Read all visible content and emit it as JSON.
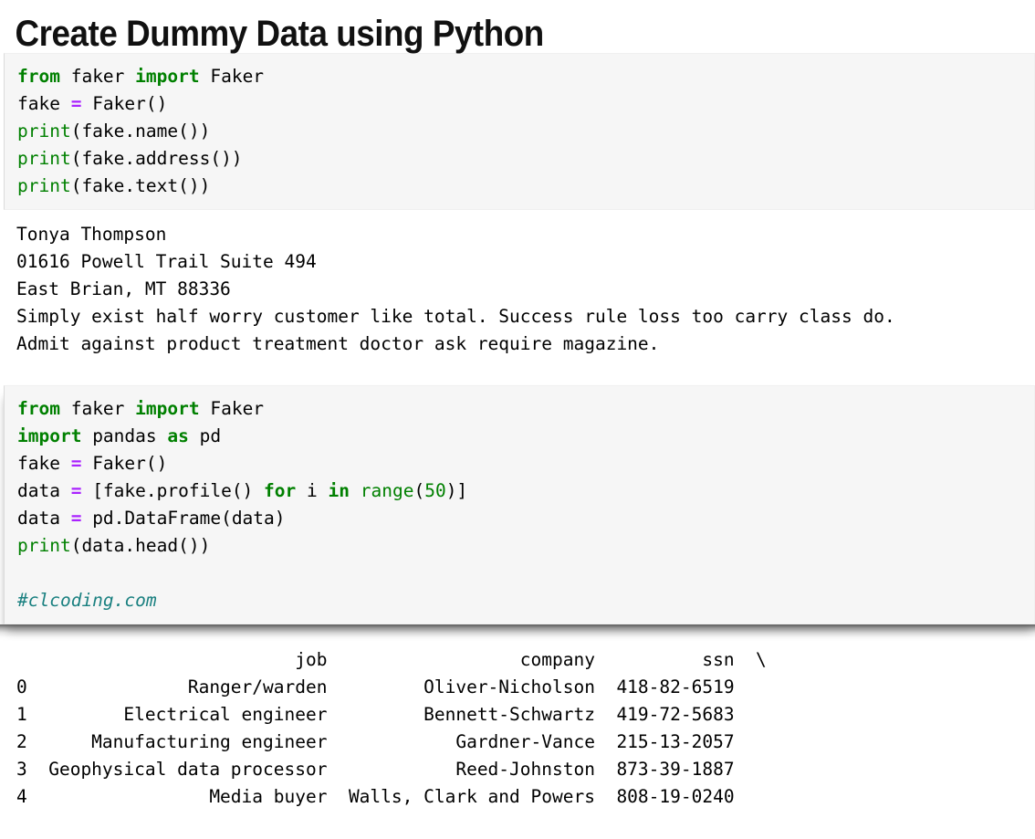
{
  "page": {
    "title": "Create Dummy Data using Python"
  },
  "code_block_1": {
    "lines": [
      [
        {
          "t": "from",
          "c": "kw"
        },
        {
          "t": " faker ",
          "c": ""
        },
        {
          "t": "import",
          "c": "kw"
        },
        {
          "t": " Faker",
          "c": ""
        }
      ],
      [
        {
          "t": "fake ",
          "c": ""
        },
        {
          "t": "=",
          "c": "op"
        },
        {
          "t": " Faker()",
          "c": ""
        }
      ],
      [
        {
          "t": "print",
          "c": "bi"
        },
        {
          "t": "(fake.name())",
          "c": ""
        }
      ],
      [
        {
          "t": "print",
          "c": "bi"
        },
        {
          "t": "(fake.address())",
          "c": ""
        }
      ],
      [
        {
          "t": "print",
          "c": "bi"
        },
        {
          "t": "(fake.text())",
          "c": ""
        }
      ]
    ],
    "plain": "from faker import Faker\nfake = Faker()\nprint(fake.name())\nprint(fake.address())\nprint(fake.text())"
  },
  "output_1": {
    "lines": [
      "Tonya Thompson",
      "01616 Powell Trail Suite 494",
      "East Brian, MT 88336",
      "Simply exist half worry customer like total. Success rule loss too carry class do.",
      "Admit against product treatment doctor ask require magazine."
    ]
  },
  "code_block_2": {
    "lines": [
      [
        {
          "t": "from",
          "c": "kw"
        },
        {
          "t": " faker ",
          "c": ""
        },
        {
          "t": "import",
          "c": "kw"
        },
        {
          "t": " Faker",
          "c": ""
        }
      ],
      [
        {
          "t": "import",
          "c": "kw"
        },
        {
          "t": " pandas ",
          "c": ""
        },
        {
          "t": "as",
          "c": "kw"
        },
        {
          "t": " pd",
          "c": ""
        }
      ],
      [
        {
          "t": "fake ",
          "c": ""
        },
        {
          "t": "=",
          "c": "op"
        },
        {
          "t": " Faker()",
          "c": ""
        }
      ],
      [
        {
          "t": "data ",
          "c": ""
        },
        {
          "t": "=",
          "c": "op"
        },
        {
          "t": " [fake.profile() ",
          "c": ""
        },
        {
          "t": "for",
          "c": "kw"
        },
        {
          "t": " i ",
          "c": ""
        },
        {
          "t": "in",
          "c": "kw"
        },
        {
          "t": " ",
          "c": ""
        },
        {
          "t": "range",
          "c": "bi"
        },
        {
          "t": "(",
          "c": ""
        },
        {
          "t": "50",
          "c": "num"
        },
        {
          "t": ")]",
          "c": ""
        }
      ],
      [
        {
          "t": "data ",
          "c": ""
        },
        {
          "t": "=",
          "c": "op"
        },
        {
          "t": " pd.DataFrame(data)",
          "c": ""
        }
      ],
      [
        {
          "t": "print",
          "c": "bi"
        },
        {
          "t": "(data.head())",
          "c": ""
        }
      ],
      [
        {
          "t": "",
          "c": ""
        }
      ],
      [
        {
          "t": "#clcoding.com",
          "c": "cmt"
        }
      ]
    ],
    "plain": "from faker import Faker\nimport pandas as pd\nfake = Faker()\ndata = [fake.profile() for i in range(50)]\ndata = pd.DataFrame(data)\nprint(data.head())\n\n#clcoding.com",
    "watermark": "#clcoding.com"
  },
  "dataframe_output": {
    "columns": [
      "job",
      "company",
      "ssn"
    ],
    "continuation_marker": "\\",
    "index": [
      "0",
      "1",
      "2",
      "3",
      "4"
    ],
    "rows": [
      {
        "index": "0",
        "job": "Ranger/warden",
        "company": "Oliver-Nicholson",
        "ssn": "418-82-6519"
      },
      {
        "index": "1",
        "job": "Electrical engineer",
        "company": "Bennett-Schwartz",
        "ssn": "419-72-5683"
      },
      {
        "index": "2",
        "job": "Manufacturing engineer",
        "company": "Gardner-Vance",
        "ssn": "215-13-2057"
      },
      {
        "index": "3",
        "job": "Geophysical data processor",
        "company": "Reed-Johnston",
        "ssn": "873-39-1887"
      },
      {
        "index": "4",
        "job": "Media buyer",
        "company": "Walls, Clark and Powers",
        "ssn": "808-19-0240"
      }
    ],
    "rendered": "                          job                   company          ssn  \\\n0             Ranger/warden          Oliver-Nicholson  418-82-6519\n1       Electrical engineer         Bennett-Schwartz  419-72-5683\n2    Manufacturing engineer            Gardner-Vance  215-13-2057\n3  Geophysical data processor          Reed-Johnston  873-39-1887\n4               Media buyer  Walls, Clark and Powers  808-19-0240"
  },
  "colors": {
    "keyword_green": "#008000",
    "operator_purple": "#aa22ff",
    "comment_teal": "#1a8080",
    "code_background": "#f6f6f6",
    "page_background": "#ffffff",
    "text": "#000000"
  }
}
